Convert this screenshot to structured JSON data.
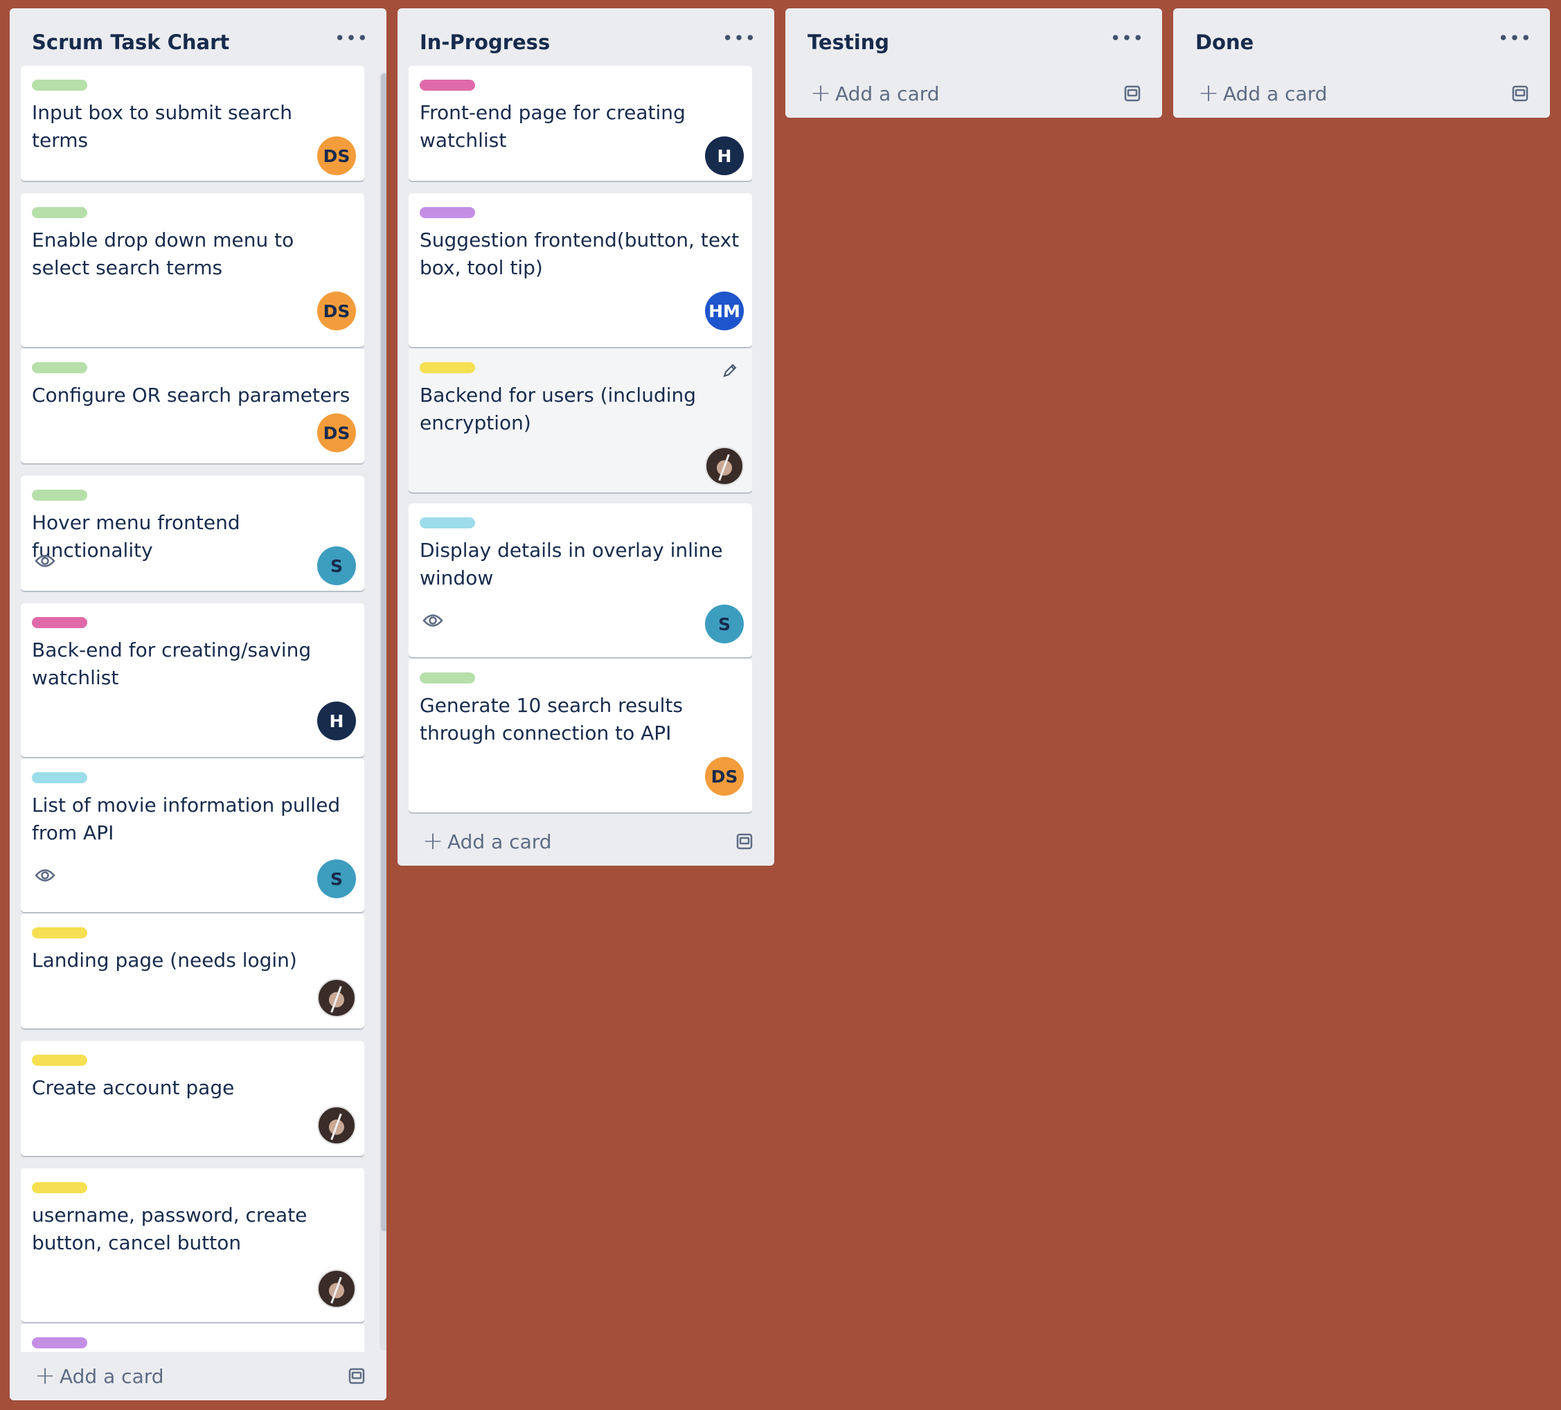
{
  "board": {
    "background": "#a34f3a"
  },
  "add_card_label": "Add a card",
  "colors": {
    "green": "#b7dfaa",
    "pink": "#e06aa9",
    "cyan": "#9cdde9",
    "yellow": "#f5e052",
    "purple": "#c48ee5",
    "avatar_orange": "#f39c3b",
    "avatar_navy": "#172b4d",
    "avatar_blue": "#1f55cc",
    "avatar_teal": "#3d9dbf"
  },
  "lists": [
    {
      "title": "Scrum Task Chart",
      "cards": [
        {
          "label_color": "green",
          "title": "Input box to submit search terms",
          "avatar": "DS"
        },
        {
          "label_color": "green",
          "title": "Enable drop down menu to select search terms",
          "avatar": "DS"
        },
        {
          "label_color": "green",
          "title": "Configure OR search parameters",
          "avatar": "DS"
        },
        {
          "label_color": "green",
          "title": "Hover menu frontend functionality",
          "avatar": "S",
          "watching": true
        },
        {
          "label_color": "pink",
          "title": "Back-end for creating/saving watchlist",
          "avatar": "H"
        },
        {
          "label_color": "cyan",
          "title": "List of movie information pulled from API",
          "avatar": "S",
          "watching": true
        },
        {
          "label_color": "yellow",
          "title": "Landing page (needs login)",
          "avatar": "photo"
        },
        {
          "label_color": "yellow",
          "title": "Create account page",
          "avatar": "photo"
        },
        {
          "label_color": "yellow",
          "title": "username, password, create button, cancel button",
          "avatar": "photo"
        },
        {
          "label_color": "purple",
          "title": "",
          "avatar": ""
        }
      ]
    },
    {
      "title": "In-Progress",
      "cards": [
        {
          "label_color": "pink",
          "title": "Front-end page for creating watchlist",
          "avatar": "H"
        },
        {
          "label_color": "purple",
          "title": "Suggestion frontend(button, text box, tool tip)",
          "avatar": "HM"
        },
        {
          "label_color": "yellow",
          "title": "Backend for users (including encryption)",
          "avatar": "photo",
          "editing": true
        },
        {
          "label_color": "cyan",
          "title": "Display details in overlay inline window",
          "avatar": "S",
          "watching": true
        },
        {
          "label_color": "green",
          "title": "Generate 10 search results through connection to API",
          "avatar": "DS"
        }
      ]
    },
    {
      "title": "Testing",
      "cards": []
    },
    {
      "title": "Done",
      "cards": []
    }
  ]
}
